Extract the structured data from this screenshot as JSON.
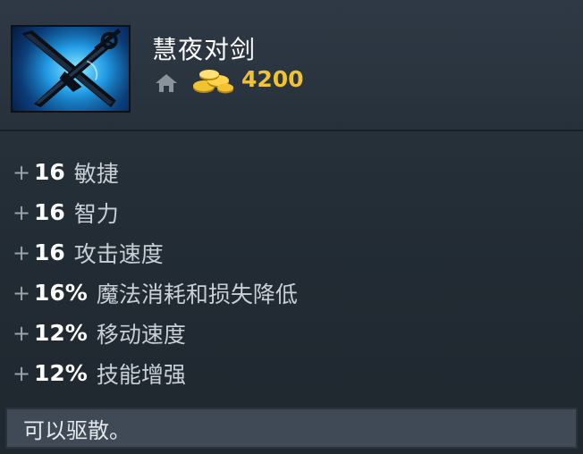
{
  "item": {
    "name": "慧夜对剑",
    "cost": "4200",
    "icon": "twin-swords-icon",
    "shop_icon": "home-icon",
    "gold_icon": "gold-coins-icon"
  },
  "stats": [
    {
      "plus": "+",
      "value": "16",
      "name": "敏捷"
    },
    {
      "plus": "+",
      "value": "16",
      "name": "智力"
    },
    {
      "plus": "+",
      "value": "16",
      "name": "攻击速度"
    },
    {
      "plus": "+",
      "value": "16%",
      "name": "魔法消耗和损失降低"
    },
    {
      "plus": "+",
      "value": "12%",
      "name": "移动速度"
    },
    {
      "plus": "+",
      "value": "12%",
      "name": "技能增强"
    }
  ],
  "note": "可以驱散。",
  "colors": {
    "gold": "#f1c232",
    "background": "#222b33",
    "note_background": "#3f4a56"
  }
}
